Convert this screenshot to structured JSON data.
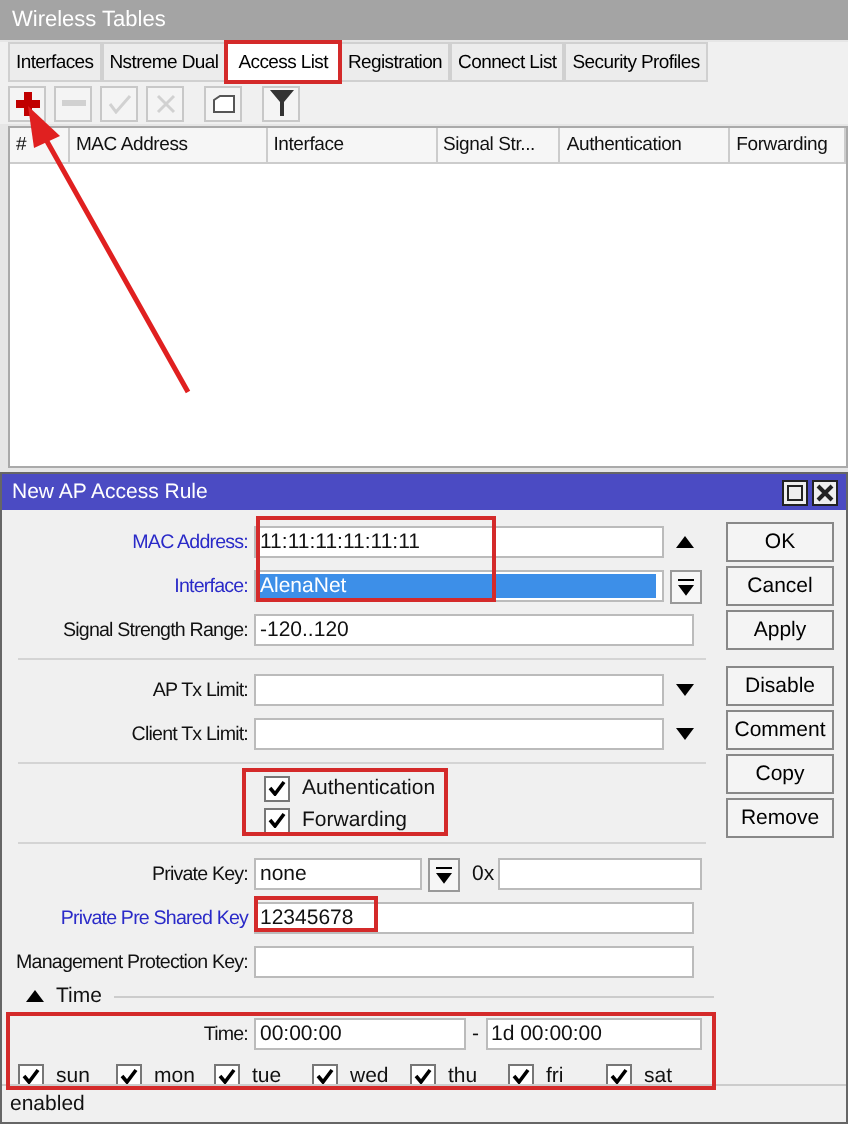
{
  "window": {
    "title": "Wireless Tables"
  },
  "tabs": [
    {
      "label": "Interfaces",
      "selected": false
    },
    {
      "label": "Nstreme Dual",
      "selected": false
    },
    {
      "label": "Access List",
      "selected": true
    },
    {
      "label": "Registration",
      "selected": false
    },
    {
      "label": "Connect List",
      "selected": false
    },
    {
      "label": "Security Profiles",
      "selected": false
    }
  ],
  "toolbar": [
    {
      "kind": "add",
      "disabled": false
    },
    {
      "kind": "remove",
      "disabled": true
    },
    {
      "kind": "enable",
      "disabled": true
    },
    {
      "kind": "disable",
      "disabled": true
    },
    {
      "kind": "comment",
      "disabled": false
    },
    {
      "kind": "filter",
      "disabled": false
    }
  ],
  "table": {
    "columns": [
      "#",
      "MAC Address",
      "Interface",
      "Signal Str...",
      "Authentication",
      "Forwarding"
    ]
  },
  "dialog": {
    "title": "New AP Access Rule",
    "fields": [
      {
        "kind": "updown",
        "label": "MAC Address:",
        "value": "11:11:11:11:11:11",
        "modified": true
      },
      {
        "kind": "select",
        "label": "Interface:",
        "value": "AlenaNet",
        "modified": true,
        "highlighted": true
      },
      {
        "kind": "text",
        "label": "Signal Strength Range:",
        "value": "-120..120",
        "modified": false
      },
      {
        "kind": "divider"
      },
      {
        "kind": "dropdown",
        "label": "AP Tx Limit:",
        "modified": false
      },
      {
        "kind": "dropdown",
        "label": "Client Tx Limit:",
        "modified": false
      },
      {
        "kind": "divider"
      },
      {
        "kind": "check",
        "label": "Authentication",
        "checked": true
      },
      {
        "kind": "check",
        "label": "Forwarding",
        "checked": true
      },
      {
        "kind": "divider"
      },
      {
        "kind": "key",
        "label": "Private Key:",
        "value": "none",
        "prefix": "0x",
        "modified": false
      },
      {
        "kind": "text",
        "label": "Private Pre Shared Key",
        "value": "12345678",
        "modified": true
      },
      {
        "kind": "text",
        "label": "Management Protection Key:",
        "modified": false
      }
    ],
    "time_section": {
      "title": "Time",
      "expanded": true,
      "label": "Time:",
      "from": "00:00:00",
      "separator": "-",
      "to": "1d 00:00:00",
      "days": [
        {
          "label": "sun",
          "checked": true
        },
        {
          "label": "mon",
          "checked": true
        },
        {
          "label": "tue",
          "checked": true
        },
        {
          "label": "wed",
          "checked": true
        },
        {
          "label": "thu",
          "checked": true
        },
        {
          "label": "fri",
          "checked": true
        },
        {
          "label": "sat",
          "checked": true
        }
      ]
    },
    "buttons": [
      "OK",
      "Cancel",
      "Apply",
      "Disable",
      "Comment",
      "Copy",
      "Remove"
    ],
    "status": "enabled"
  }
}
